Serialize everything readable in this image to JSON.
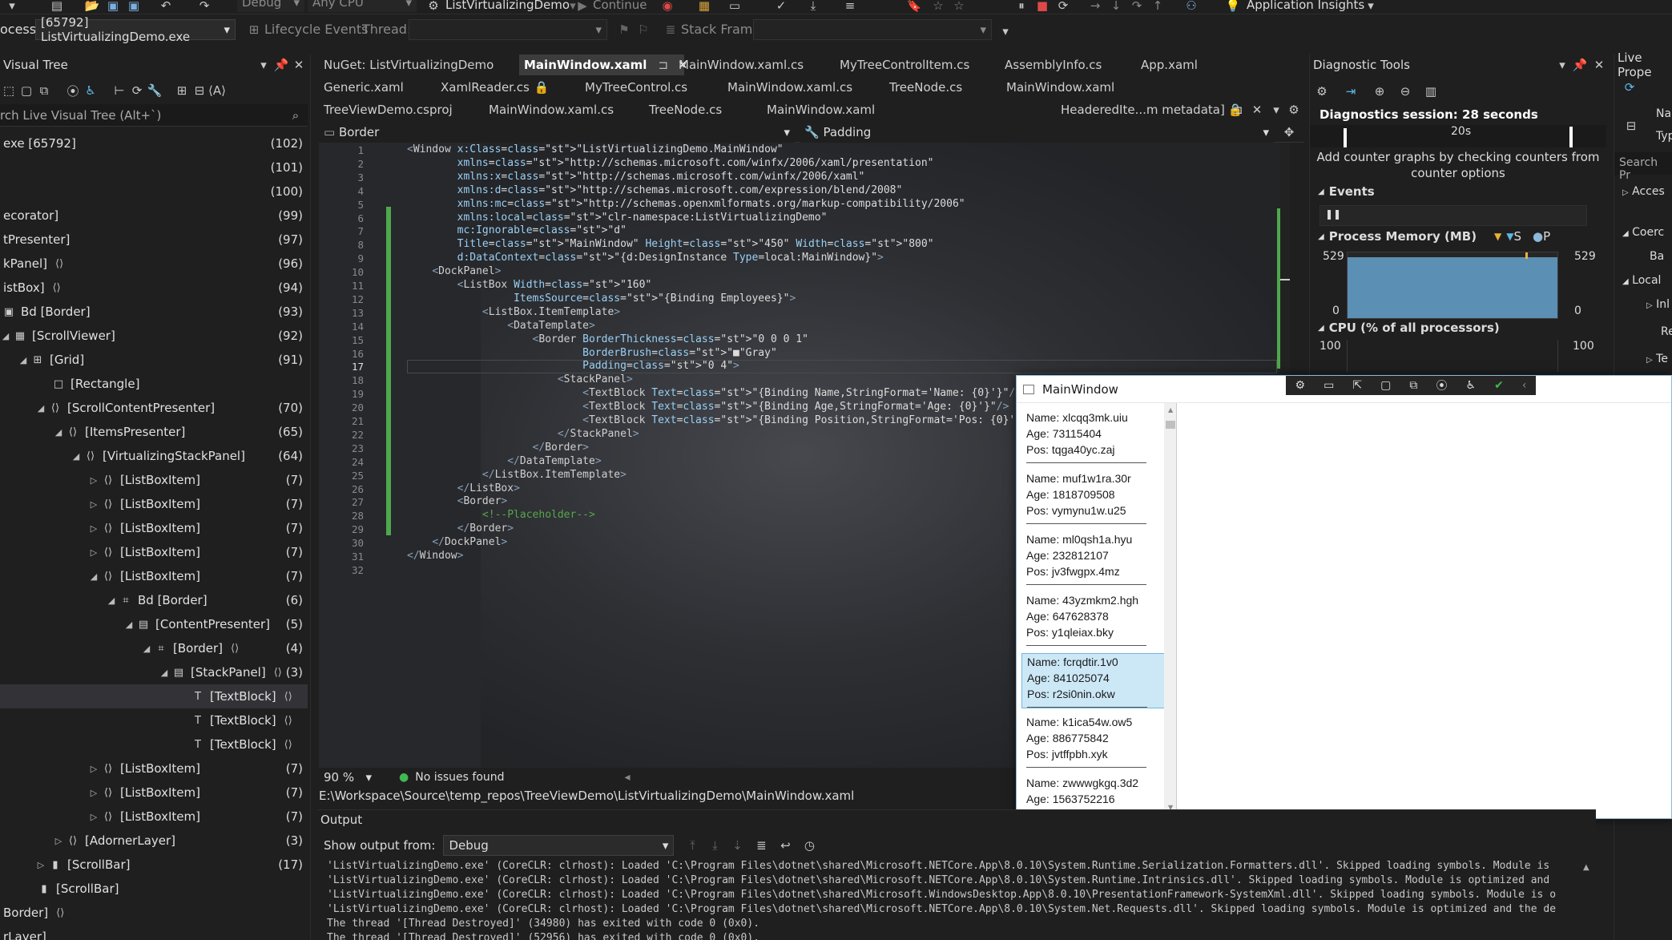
{
  "toolbar": {
    "config": "Debug",
    "platform": "Any CPU",
    "startup_project": "ListVirtualizingDemo",
    "continue_label": "Continue",
    "app_insights": "Application Insights",
    "process_label": "ocess:",
    "process_value": "[65792] ListVirtualizingDemo.exe",
    "lifecycle_label": "Lifecycle Events",
    "thread_label": "Thread:",
    "thread_value": "",
    "stackframe_label": "Stack Frame:",
    "stackframe_value": ""
  },
  "live_visual_tree": {
    "title": "Visual Tree",
    "search_placeholder": "rch Live Visual Tree (Alt+`)",
    "rows": [
      {
        "label": "exe [65792]",
        "count": "(102)"
      },
      {
        "label": "",
        "count": "(101)"
      },
      {
        "label": "",
        "count": "(100)"
      },
      {
        "label": "ecorator]",
        "count": "(99)"
      },
      {
        "label": "tPresenter]",
        "count": "(97)"
      },
      {
        "label": "kPanel]",
        "count": "(96)"
      },
      {
        "label": "istBox]",
        "count": "(94)"
      },
      {
        "label": "Bd [Border]",
        "count": "(93)"
      },
      {
        "label": "[ScrollViewer]",
        "count": "(92)"
      },
      {
        "label": "[Grid]",
        "count": "(91)"
      },
      {
        "label": "[Rectangle]",
        "count": ""
      },
      {
        "label": "[ScrollContentPresenter]",
        "count": "(70)"
      },
      {
        "label": "[ItemsPresenter]",
        "count": "(65)"
      },
      {
        "label": "[VirtualizingStackPanel]",
        "count": "(64)"
      },
      {
        "label": "[ListBoxItem]",
        "count": "(7)"
      },
      {
        "label": "[ListBoxItem]",
        "count": "(7)"
      },
      {
        "label": "[ListBoxItem]",
        "count": "(7)"
      },
      {
        "label": "[ListBoxItem]",
        "count": "(7)"
      },
      {
        "label": "[ListBoxItem]",
        "count": "(7)"
      },
      {
        "label": "Bd [Border]",
        "count": "(6)"
      },
      {
        "label": "[ContentPresenter]",
        "count": "(5)"
      },
      {
        "label": "[Border]",
        "count": "(4)"
      },
      {
        "label": "[StackPanel]",
        "count": "(3)"
      },
      {
        "label": "[TextBlock]",
        "count": ""
      },
      {
        "label": "[TextBlock]",
        "count": ""
      },
      {
        "label": "[TextBlock]",
        "count": ""
      },
      {
        "label": "[ListBoxItem]",
        "count": "(7)"
      },
      {
        "label": "[ListBoxItem]",
        "count": "(7)"
      },
      {
        "label": "[ListBoxItem]",
        "count": "(7)"
      },
      {
        "label": "[AdornerLayer]",
        "count": "(3)"
      },
      {
        "label": "[ScrollBar]",
        "count": "(17)"
      },
      {
        "label": "[ScrollBar]",
        "count": ""
      },
      {
        "label": "Border]",
        "count": ""
      },
      {
        "label": "rLayer]",
        "count": ""
      }
    ]
  },
  "tabs": {
    "row1": [
      "NuGet: ListVirtualizingDemo",
      "MainWindow.xaml",
      "MainWindow.xaml.cs",
      "MyTreeControlItem.cs",
      "AssemblyInfo.cs",
      "App.xaml"
    ],
    "row2": [
      "Generic.xaml",
      "XamlReader.cs",
      "MyTreeControl.cs",
      "MainWindow.xaml.cs",
      "TreeNode.cs",
      "MainWindow.xaml"
    ],
    "row3": [
      "TreeViewDemo.csproj",
      "MainWindow.xaml.cs",
      "TreeNode.cs",
      "MainWindow.xaml",
      "HeaderedIte...m metadata]"
    ]
  },
  "editor": {
    "element_combo": "Border",
    "member_combo": "Padding",
    "zoom": "90 %",
    "issues": "No issues found",
    "file_path": "E:\\Workspace\\Source\\temp_repos\\TreeViewDemo\\ListVirtualizingDemo\\MainWindow.xaml",
    "line_numbers": [
      "1",
      "2",
      "3",
      "4",
      "5",
      "6",
      "7",
      "8",
      "9",
      "10",
      "11",
      "12",
      "13",
      "14",
      "15",
      "16",
      "17",
      "18",
      "19",
      "20",
      "21",
      "22",
      "23",
      "24",
      "25",
      "26",
      "27",
      "28",
      "29",
      "30",
      "31",
      "32"
    ],
    "lines": [
      "<Window x:Class=\"ListVirtualizingDemo.MainWindow\"",
      "        xmlns=\"http://schemas.microsoft.com/winfx/2006/xaml/presentation\"",
      "        xmlns:x=\"http://schemas.microsoft.com/winfx/2006/xaml\"",
      "        xmlns:d=\"http://schemas.microsoft.com/expression/blend/2008\"",
      "        xmlns:mc=\"http://schemas.openxmlformats.org/markup-compatibility/2006\"",
      "        xmlns:local=\"clr-namespace:ListVirtualizingDemo\"",
      "        mc:Ignorable=\"d\"",
      "        Title=\"MainWindow\" Height=\"450\" Width=\"800\"",
      "        d:DataContext=\"{d:DesignInstance Type=local:MainWindow}\">",
      "    <DockPanel>",
      "        <ListBox Width=\"160\"",
      "                 ItemsSource=\"{Binding Employees}\">",
      "            <ListBox.ItemTemplate>",
      "                <DataTemplate>",
      "                    <Border BorderThickness=\"0 0 0 1\"",
      "                            BorderBrush=\"■\"Gray\"",
      "                            Padding=\"0 4\">",
      "                        <StackPanel>",
      "                            <TextBlock Text=\"{Binding Name,StringFormat='Name: {0}'}\"/>",
      "                            <TextBlock Text=\"{Binding Age,StringFormat='Age: {0}'}\"/>",
      "                            <TextBlock Text=\"{Binding Position,StringFormat='Pos: {0}'}\"/>",
      "                        </StackPanel>",
      "                    </Border>",
      "                </DataTemplate>",
      "            </ListBox.ItemTemplate>",
      "        </ListBox>",
      "        <Border>",
      "            <!--Placeholder-->",
      "        </Border>",
      "    </DockPanel>",
      "</Window>",
      ""
    ]
  },
  "diagnostics": {
    "title": "Diagnostic Tools",
    "session": "Diagnostics session: 28 seconds",
    "timeline_tick": "20s",
    "counter_hint": "Add counter graphs by checking counters from counter options",
    "events_label": "Events",
    "memory_label": "Process Memory (MB)",
    "memory_max_left": "529",
    "memory_max_right": "529",
    "memory_min_left": "0",
    "memory_min_right": "0",
    "memory_legend_p": "P",
    "memory_legend_s": "S",
    "cpu_label": "CPU (% of all processors)",
    "cpu_max_left": "100",
    "cpu_max_right": "100"
  },
  "live_props": {
    "title": "Live Prope",
    "name_label": "Na",
    "type_label": "Typ",
    "search": "Search Pr",
    "groups": [
      "Acces",
      "Coerc",
      "Ba",
      "Local",
      "Inl",
      "Re",
      "Te"
    ]
  },
  "wpf_window": {
    "title": "MainWindow",
    "employees": [
      {
        "name": "Name: xlcqq3mk.uiu",
        "age": "Age: 73115404",
        "pos": "Pos: tqga40yc.zaj"
      },
      {
        "name": "Name: muf1w1ra.30r",
        "age": "Age: 1818709508",
        "pos": "Pos: vymynu1w.u25"
      },
      {
        "name": "Name: ml0qsh1a.hyu",
        "age": "Age: 232812107",
        "pos": "Pos: jv3fwgpx.4mz"
      },
      {
        "name": "Name: 43yzmkm2.hgh",
        "age": "Age: 647628378",
        "pos": "Pos: y1qleiax.bky"
      },
      {
        "name": "Name: fcrqdtir.1v0",
        "age": "Age: 841025074",
        "pos": "Pos: r2si0nin.okw"
      },
      {
        "name": "Name: k1ica54w.ow5",
        "age": "Age: 886775842",
        "pos": "Pos: jvtffpbh.xyk"
      },
      {
        "name": "Name: zwwwgkgq.3d2",
        "age": "Age: 1563752216",
        "pos": ""
      }
    ]
  },
  "output": {
    "title": "Output",
    "show_from_label": "Show output from:",
    "show_from_value": "Debug",
    "lines": [
      "'ListVirtualizingDemo.exe' (CoreCLR: clrhost): Loaded 'C:\\Program Files\\dotnet\\shared\\Microsoft.NETCore.App\\8.0.10\\System.Runtime.Serialization.Formatters.dll'. Skipped loading symbols. Module is",
      "'ListVirtualizingDemo.exe' (CoreCLR: clrhost): Loaded 'C:\\Program Files\\dotnet\\shared\\Microsoft.NETCore.App\\8.0.10\\System.Runtime.Intrinsics.dll'. Skipped loading symbols. Module is optimized and",
      "'ListVirtualizingDemo.exe' (CoreCLR: clrhost): Loaded 'C:\\Program Files\\dotnet\\shared\\Microsoft.WindowsDesktop.App\\8.0.10\\PresentationFramework-SystemXml.dll'. Skipped loading symbols. Module is o",
      "'ListVirtualizingDemo.exe' (CoreCLR: clrhost): Loaded 'C:\\Program Files\\dotnet\\shared\\Microsoft.NETCore.App\\8.0.10\\System.Net.Requests.dll'. Skipped loading symbols. Module is optimized and the de",
      "The thread '[Thread Destroyed]' (34980) has exited with code 0 (0x0).",
      "The thread '[Thread Destroyed]' (52956) has exited with code 0 (0x0)."
    ]
  },
  "colors": {
    "accent": "#5eb6e5",
    "change_bar": "#4ea84e",
    "selection": "#cce8f7"
  }
}
